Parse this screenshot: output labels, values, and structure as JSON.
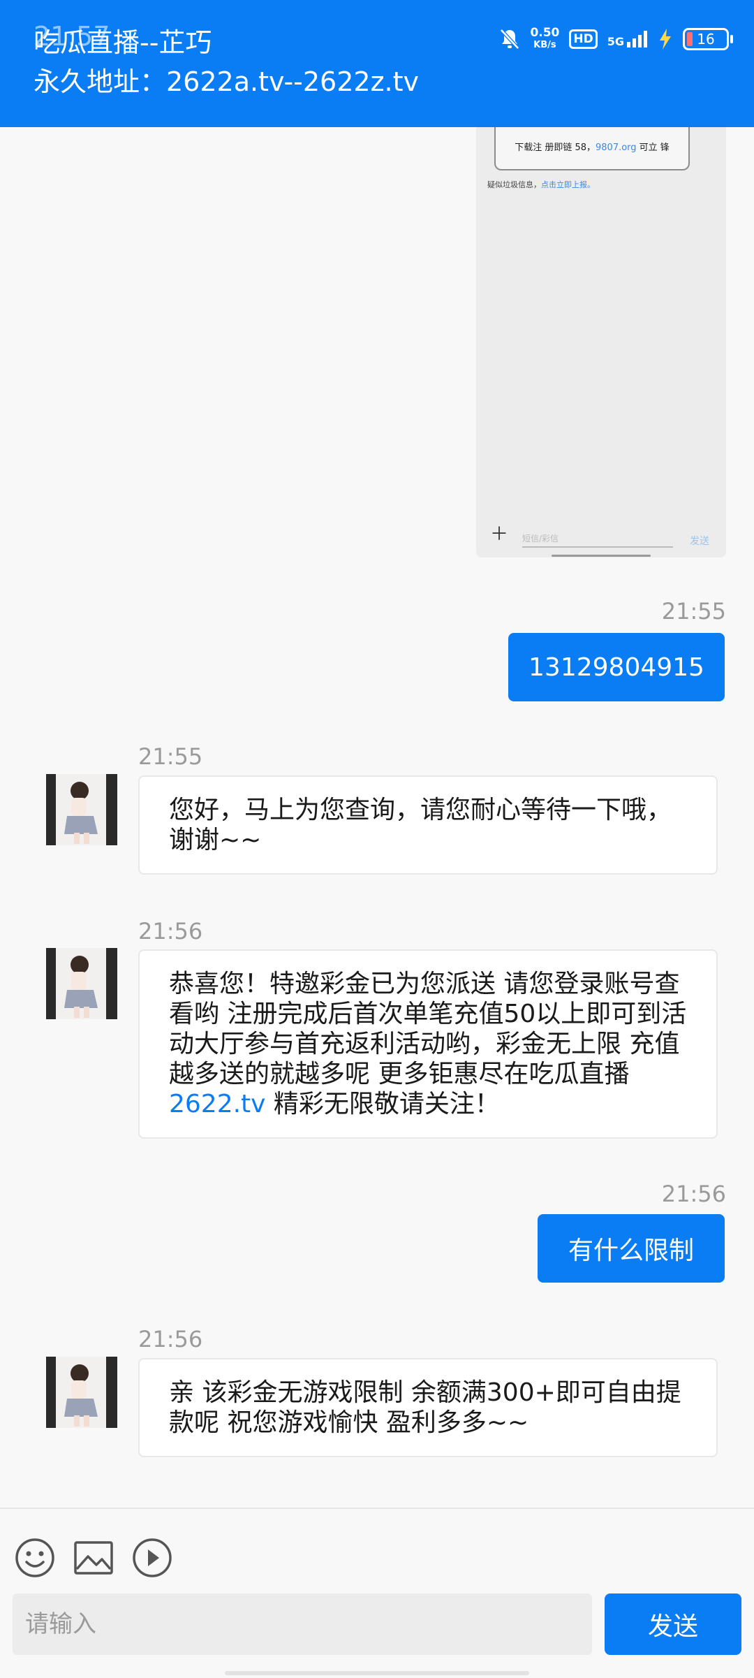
{
  "status_bar": {
    "time": "21:57",
    "net_speed_value": "0.50",
    "net_speed_unit": "KB/s",
    "hd": "HD",
    "network": "5G",
    "battery": "16"
  },
  "header": {
    "title": "吃瓜直播--芷巧",
    "subtitle": "永久地址：2622a.tv--2622z.tv"
  },
  "screenshot": {
    "message_prefix": "下载注 册即链 58，",
    "message_link": "9807.org",
    "message_suffix": " 可立 锋",
    "spam_notice": "疑似垃圾信息，",
    "spam_link": "点击立即上报。",
    "input_placeholder": "短信/彩信",
    "send_label": "发送"
  },
  "messages": [
    {
      "time": "21:55",
      "text": "13129804915"
    },
    {
      "time": "21:55",
      "text": "您好，马上为您查询，请您耐心等待一下哦，谢谢~~"
    },
    {
      "time": "21:56",
      "text": "恭喜您！特邀彩金已为您派送 请您登录账号查看哟 注册完成后首次单笔充值50以上即可到活动大厅参与首充返利活动哟，彩金无上限 充值越多送的就越多呢 更多钜惠尽在吃瓜直播",
      "link": "2622.tv",
      "suffix": " 精彩无限敬请关注！"
    },
    {
      "time": "21:56",
      "text": "有什么限制"
    },
    {
      "time": "21:56",
      "text": "亲 该彩金无游戏限制 余额满300+即可自由提款呢 祝您游戏愉快 盈利多多~~"
    }
  ],
  "composer": {
    "placeholder": "请输入",
    "send_label": "发送",
    "emoji_icon": "smiley-icon",
    "image_icon": "image-icon",
    "video_icon": "play-icon"
  },
  "colors": {
    "accent": "#0a7cf4",
    "link": "#0a7cf4",
    "timestamp": "#9a9a9a"
  }
}
